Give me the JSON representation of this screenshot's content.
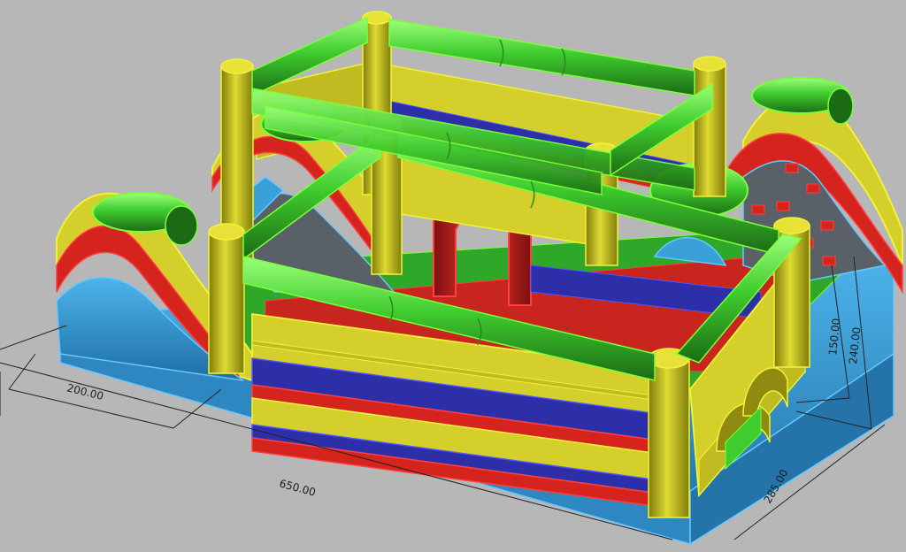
{
  "dimensions": {
    "width_small": "200.00",
    "length_total": "650.00",
    "depth_total": "285.00",
    "height_inner": "150.00",
    "height_total": "240.00"
  },
  "colors": {
    "background": "#b7b7b7",
    "green": "#3fcc2e",
    "green_dark": "#1b6b14",
    "yellow": "#d4cf2a",
    "yellow_dark": "#8e8b10",
    "red": "#d5231d",
    "red_dark": "#7e1010",
    "blue": "#2c2fa8",
    "cyan": "#3aa0d8",
    "cyan_dark": "#1d6fa5",
    "outline_yellow": "#f2f23a",
    "outline_green": "#7cff3a",
    "outline_red": "#ff4040"
  }
}
